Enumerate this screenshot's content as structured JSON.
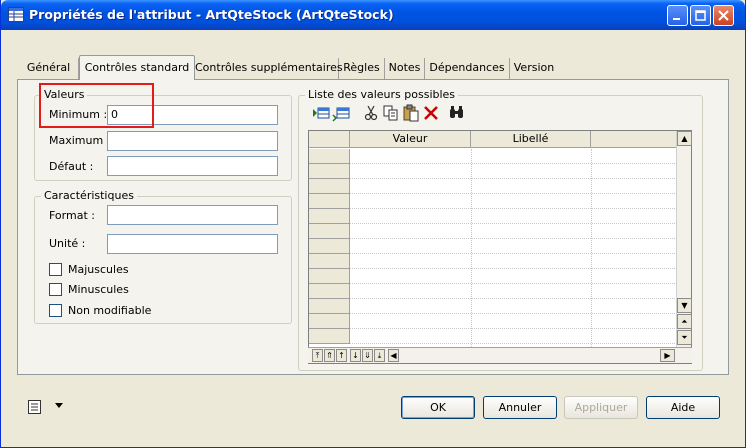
{
  "window": {
    "title": "Propriétés de l'attribut - ArtQteStock (ArtQteStock)"
  },
  "tabs": [
    {
      "label": "Général",
      "active": false
    },
    {
      "label": "Contrôles standard",
      "active": true
    },
    {
      "label": "Contrôles supplémentaires",
      "active": false
    },
    {
      "label": "Règles",
      "active": false
    },
    {
      "label": "Notes",
      "active": false
    },
    {
      "label": "Dépendances",
      "active": false
    },
    {
      "label": "Version",
      "active": false
    }
  ],
  "valeurs": {
    "group_label": "Valeurs",
    "minimum_label": "Minimum :",
    "minimum_value": "0",
    "maximum_label": "Maximum :",
    "maximum_value": "",
    "defaut_label": "Défaut :",
    "defaut_value": ""
  },
  "caracteristiques": {
    "group_label": "Caractéristiques",
    "format_label": "Format :",
    "format_value": "",
    "unite_label": "Unité :",
    "unite_value": "",
    "checkboxes": [
      {
        "label": "Majuscules",
        "checked": false
      },
      {
        "label": "Minuscules",
        "checked": false
      },
      {
        "label": "Non modifiable",
        "checked": false
      }
    ]
  },
  "liste": {
    "group_label": "Liste des valeurs possibles",
    "columns": [
      "Valeur",
      "Libellé"
    ],
    "tools": [
      "insert-row-icon",
      "add-row-icon",
      "cut-icon",
      "copy-icon",
      "paste-icon",
      "delete-icon",
      "find-icon"
    ]
  },
  "buttons": {
    "ok": "OK",
    "annuler": "Annuler",
    "appliquer": "Appliquer",
    "aide": "Aide"
  },
  "colors": {
    "title_bar": "#0054e3",
    "highlight": "#e21b1b",
    "delete_icon": "#cc0000"
  }
}
